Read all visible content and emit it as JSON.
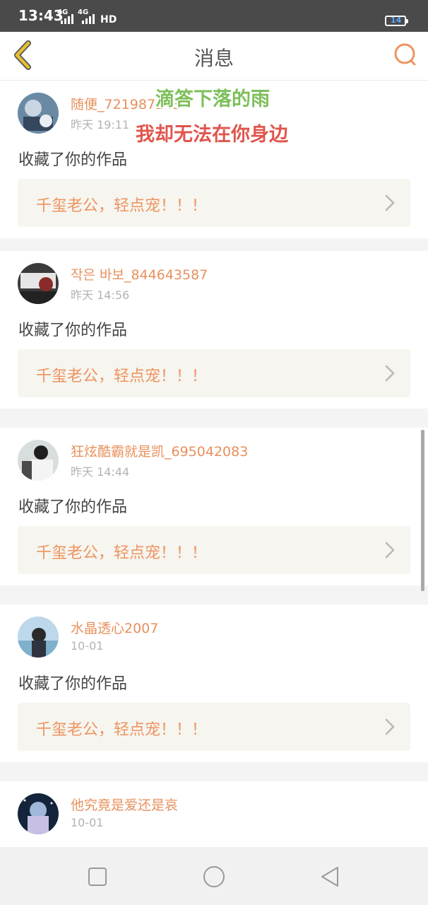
{
  "status_bar": {
    "time": "13:43",
    "signal1": "4G",
    "signal2": "4G",
    "hd": "HD",
    "battery": "14"
  },
  "header": {
    "title": "消息"
  },
  "overlay": {
    "line1": "滴答下落的雨",
    "line2": "我却无法在你身边"
  },
  "messages": [
    {
      "username": "随便_721987243",
      "time": "昨天 19:11",
      "action": "收藏了你的作品",
      "work_title": "千玺老公，轻点宠！！！"
    },
    {
      "username": "작은 바보_844643587",
      "time": "昨天 14:56",
      "action": "收藏了你的作品",
      "work_title": "千玺老公，轻点宠！！！"
    },
    {
      "username": "狂炫酷霸就是凯_695042083",
      "time": "昨天 14:44",
      "action": "收藏了你的作品",
      "work_title": "千玺老公，轻点宠！！！"
    },
    {
      "username": "水晶透心2007",
      "time": "10-01",
      "action": "收藏了你的作品",
      "work_title": "千玺老公，轻点宠！！！"
    },
    {
      "username": "他究竟是爱还是哀",
      "time": "10-01",
      "action": "",
      "work_title": ""
    }
  ],
  "colors": {
    "accent": "#e8905c",
    "work_bg": "#f6f5ef",
    "back_icon": "#e8c030"
  },
  "icons": {
    "back": "chevron-left-icon",
    "search": "search-icon",
    "chevron": "chevron-right-icon",
    "nav_recent": "square-icon",
    "nav_home": "circle-icon",
    "nav_back": "triangle-left-icon"
  }
}
